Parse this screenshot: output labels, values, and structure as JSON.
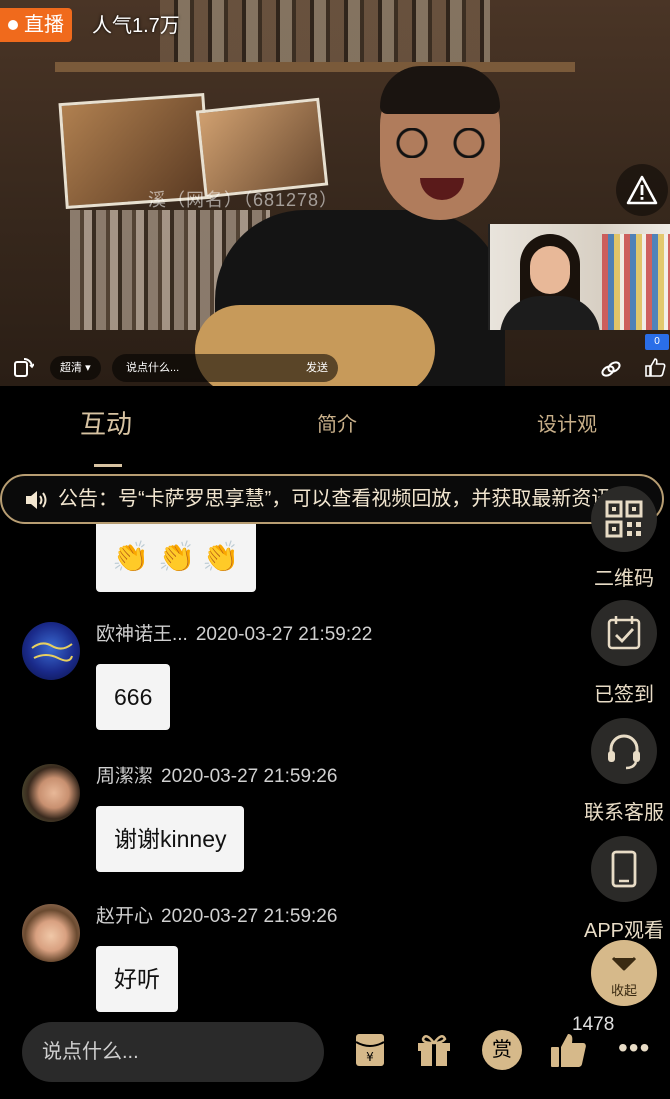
{
  "video": {
    "live_label": "直播",
    "popularity": "人气1.7万",
    "overlay_text": "溪（网名）（681278）",
    "quality": "超清",
    "danmaku_placeholder": "说点什么...",
    "send_label": "发送",
    "pip_badge": "0"
  },
  "tabs": [
    {
      "label": "互动",
      "active": true
    },
    {
      "label": "简介",
      "active": false
    },
    {
      "label": "设计观",
      "active": false
    }
  ],
  "notice": {
    "text": "公告：号“卡萨罗思享慧”，可以查看视频回放，并获取最新资讯"
  },
  "chat": {
    "top_bubble_emojis": [
      "👏",
      "👏",
      "👏"
    ],
    "messages": [
      {
        "name": "欧神诺王...",
        "time": "2020-03-27 21:59:22",
        "text": "666"
      },
      {
        "name": "周潔潔",
        "time": "2020-03-27 21:59:26",
        "text": "谢谢kinney"
      },
      {
        "name": "赵开心",
        "time": "2020-03-27 21:59:26",
        "text": "好听"
      }
    ]
  },
  "side_actions": {
    "qrcode": "二维码",
    "signed": "已签到",
    "service": "联系客服",
    "app": "APP观看",
    "collapse": "收起"
  },
  "bottom": {
    "placeholder": "说点什么...",
    "reward_label": "赏",
    "like_count": "1478"
  },
  "colors": {
    "accent_gold": "#d7c3a2",
    "live_orange": "#f06a1c",
    "notice_border": "#b79d72"
  }
}
